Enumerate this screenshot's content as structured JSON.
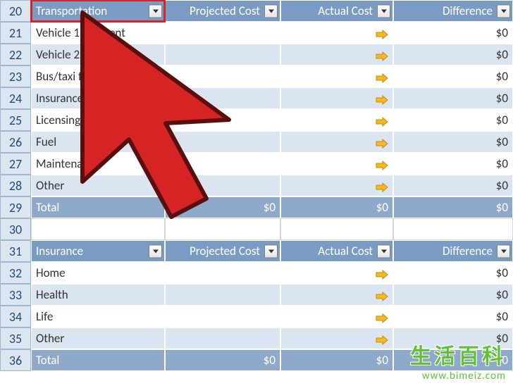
{
  "rows": [
    {
      "num": "20",
      "type": "header",
      "selected": true,
      "cols": [
        "Transportation",
        "Projected Cost",
        "Actual Cost",
        "Difference"
      ]
    },
    {
      "num": "21",
      "type": "data",
      "banded": false,
      "label": "Vehicle 1 payment",
      "proj": "",
      "actual_arrow": true,
      "diff": "$0"
    },
    {
      "num": "22",
      "type": "data",
      "banded": true,
      "label": "Vehicle 2 payment",
      "proj": "",
      "actual_arrow": true,
      "diff": "$0"
    },
    {
      "num": "23",
      "type": "data",
      "banded": false,
      "label": "Bus/taxi fare",
      "proj": "",
      "actual_arrow": true,
      "diff": "$0"
    },
    {
      "num": "24",
      "type": "data",
      "banded": true,
      "label": "Insurance",
      "proj": "",
      "actual_arrow": true,
      "diff": "$0"
    },
    {
      "num": "25",
      "type": "data",
      "banded": false,
      "label": "Licensing",
      "proj": "",
      "actual_arrow": true,
      "diff": "$0"
    },
    {
      "num": "26",
      "type": "data",
      "banded": true,
      "label": "Fuel",
      "proj": "",
      "actual_arrow": true,
      "diff": "$0"
    },
    {
      "num": "27",
      "type": "data",
      "banded": false,
      "label": "Maintenance",
      "proj": "",
      "actual_arrow": true,
      "diff": "$0"
    },
    {
      "num": "28",
      "type": "data",
      "banded": true,
      "label": "Other",
      "proj": "",
      "actual_arrow": true,
      "diff": "$0"
    },
    {
      "num": "29",
      "type": "total",
      "label": "Total",
      "proj": "$0",
      "actual": "$0",
      "diff": "$0"
    },
    {
      "num": "30",
      "type": "empty"
    },
    {
      "num": "31",
      "type": "header",
      "selected": false,
      "cols": [
        "Insurance",
        "Projected Cost",
        "Actual Cost",
        "Difference"
      ]
    },
    {
      "num": "32",
      "type": "data",
      "banded": false,
      "label": "Home",
      "proj": "",
      "actual_arrow": true,
      "diff": "$0"
    },
    {
      "num": "33",
      "type": "data",
      "banded": true,
      "label": "Health",
      "proj": "",
      "actual_arrow": true,
      "diff": "$0"
    },
    {
      "num": "34",
      "type": "data",
      "banded": false,
      "label": "Life",
      "proj": "",
      "actual_arrow": true,
      "diff": "$0"
    },
    {
      "num": "35",
      "type": "data",
      "banded": true,
      "label": "Other",
      "proj": "",
      "actual_arrow": true,
      "diff": "$0"
    },
    {
      "num": "36",
      "type": "total",
      "label": "Total",
      "proj": "$0",
      "actual": "$0",
      "diff": "$0"
    }
  ],
  "watermark": {
    "cn": "生活百科",
    "url": "www.bimeiz.com"
  }
}
